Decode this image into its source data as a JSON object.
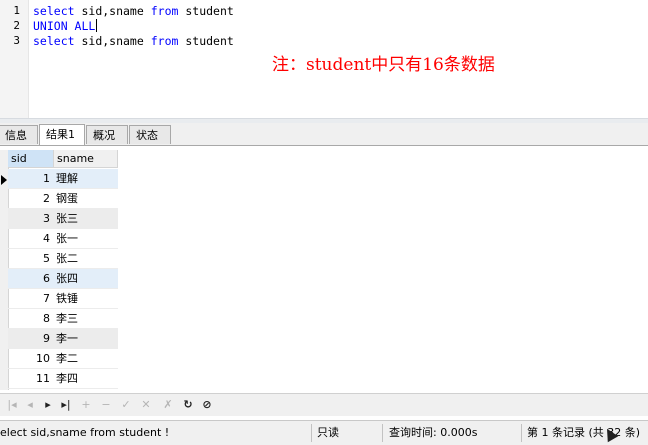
{
  "editor": {
    "lines": [
      {
        "num": "1",
        "kw1": "select",
        "mid": " sid,sname ",
        "kw2": "from",
        "tail": " student"
      },
      {
        "num": "2",
        "kw1": "UNION ALL",
        "mid": "",
        "kw2": "",
        "tail": ""
      },
      {
        "num": "3",
        "kw1": "select",
        "mid": " sid,sname ",
        "kw2": "from",
        "tail": " student"
      }
    ],
    "annotation": "注：student中只有16条数据"
  },
  "tabs": [
    "信息",
    "结果1",
    "概况",
    "状态"
  ],
  "grid": {
    "columns": [
      "sid",
      "sname"
    ],
    "rows": [
      {
        "sid": "1",
        "sname": "理解"
      },
      {
        "sid": "2",
        "sname": "钢蛋"
      },
      {
        "sid": "3",
        "sname": "张三"
      },
      {
        "sid": "4",
        "sname": "张一"
      },
      {
        "sid": "5",
        "sname": "张二"
      },
      {
        "sid": "6",
        "sname": "张四"
      },
      {
        "sid": "7",
        "sname": "铁锤"
      },
      {
        "sid": "8",
        "sname": "李三"
      },
      {
        "sid": "9",
        "sname": "李一"
      },
      {
        "sid": "10",
        "sname": "李二"
      },
      {
        "sid": "11",
        "sname": "李四"
      }
    ]
  },
  "navbar": {
    "icons": [
      "first-record-icon",
      "prev-page-icon",
      "next-record-icon",
      "last-record-icon",
      "add-record-icon",
      "delete-record-icon",
      "apply-icon",
      "cancel-icon",
      "clear-icon",
      "refresh-icon",
      "stop-icon"
    ]
  },
  "status": {
    "sql": "elect sid,sname from student !",
    "mode": "只读",
    "query_time": "查询时间: 0.000s",
    "record_info": "第 1 条记录 (共 32 条)"
  },
  "colors": {
    "keyword": "#0000ff",
    "annotation": "#ff0000",
    "header_selected": "#cfe3f6"
  }
}
